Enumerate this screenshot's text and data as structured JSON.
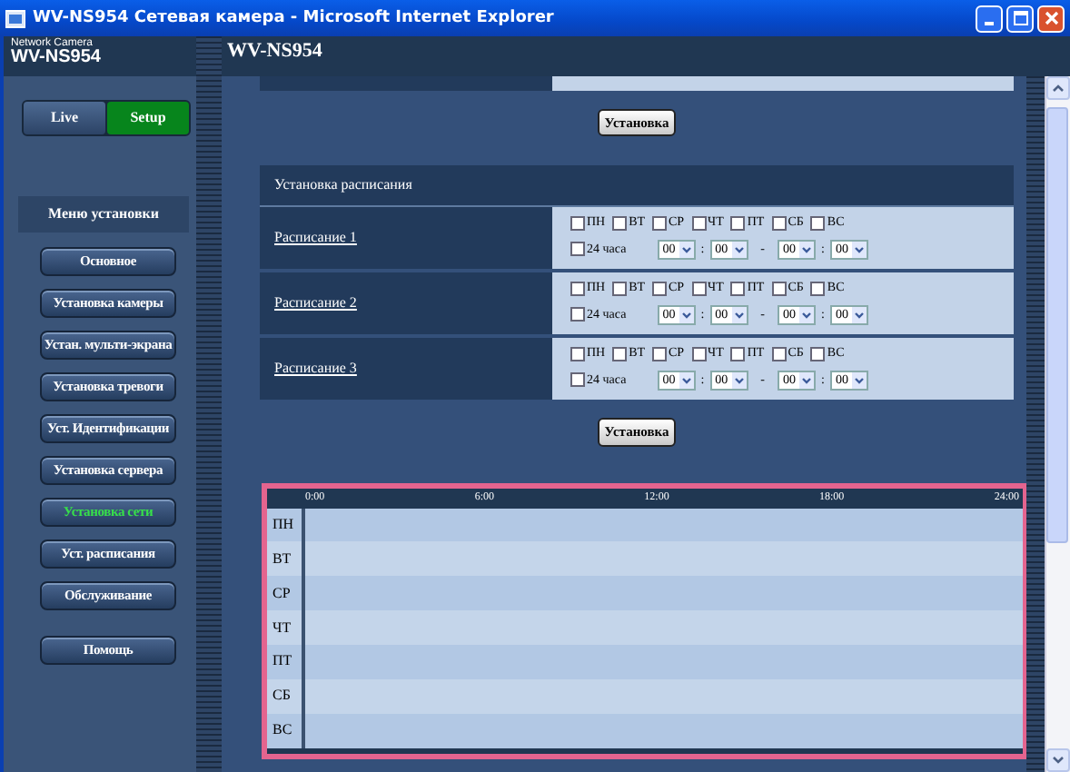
{
  "window": {
    "title": "WV-NS954 Сетевая камера - Microsoft Internet Explorer"
  },
  "brand": {
    "subtitle": "Network Camera",
    "model": "WV-NS954"
  },
  "page_title": "WV-NS954",
  "modes": [
    {
      "label": "Live",
      "selected": false
    },
    {
      "label": "Setup",
      "selected": true
    }
  ],
  "menu": {
    "title": "Меню установки",
    "items": [
      {
        "label": "Основное",
        "selected": false
      },
      {
        "label": "Установка камеры",
        "selected": false
      },
      {
        "label": "Устан. мульти-экрана",
        "selected": false
      },
      {
        "label": "Установка тревоги",
        "selected": false
      },
      {
        "label": "Уст. Идентификации",
        "selected": false
      },
      {
        "label": "Установка сервера",
        "selected": false
      },
      {
        "label": "Установка сети",
        "selected": true
      },
      {
        "label": "Уст. расписания",
        "selected": false
      },
      {
        "label": "Обслуживание",
        "selected": false
      }
    ],
    "help": "Помощь"
  },
  "apply_button_top": "Установка",
  "schedule_section": {
    "title": "Установка расписания",
    "schedules": [
      {
        "label": "Расписание 1",
        "days": [
          {
            "label": "ПН",
            "checked": false
          },
          {
            "label": "ВТ",
            "checked": false
          },
          {
            "label": "СР",
            "checked": false
          },
          {
            "label": "ЧТ",
            "checked": false
          },
          {
            "label": "ПТ",
            "checked": false
          },
          {
            "label": "СБ",
            "checked": false
          },
          {
            "label": "ВС",
            "checked": false
          }
        ],
        "all_day": {
          "label": "24 часа",
          "checked": false
        },
        "start": [
          "00",
          "00"
        ],
        "end": [
          "00",
          "00"
        ]
      },
      {
        "label": "Расписание 2",
        "days": [
          {
            "label": "ПН",
            "checked": false
          },
          {
            "label": "ВТ",
            "checked": false
          },
          {
            "label": "СР",
            "checked": false
          },
          {
            "label": "ЧТ",
            "checked": false
          },
          {
            "label": "ПТ",
            "checked": false
          },
          {
            "label": "СБ",
            "checked": false
          },
          {
            "label": "ВС",
            "checked": false
          }
        ],
        "all_day": {
          "label": "24 часа",
          "checked": false
        },
        "start": [
          "00",
          "00"
        ],
        "end": [
          "00",
          "00"
        ]
      },
      {
        "label": "Расписание 3",
        "days": [
          {
            "label": "ПН",
            "checked": false
          },
          {
            "label": "ВТ",
            "checked": false
          },
          {
            "label": "СР",
            "checked": false
          },
          {
            "label": "ЧТ",
            "checked": false
          },
          {
            "label": "ПТ",
            "checked": false
          },
          {
            "label": "СБ",
            "checked": false
          },
          {
            "label": "ВС",
            "checked": false
          }
        ],
        "all_day": {
          "label": "24 часа",
          "checked": false
        },
        "start": [
          "00",
          "00"
        ],
        "end": [
          "00",
          "00"
        ]
      }
    ],
    "time_colon": ":",
    "time_dash": "-"
  },
  "apply_button_bottom": "Установка",
  "timeline": {
    "hours": [
      "0:00",
      "6:00",
      "12:00",
      "18:00",
      "24:00"
    ],
    "days": [
      "ПН",
      "ВТ",
      "СР",
      "ЧТ",
      "ПТ",
      "СБ",
      "ВС"
    ]
  }
}
